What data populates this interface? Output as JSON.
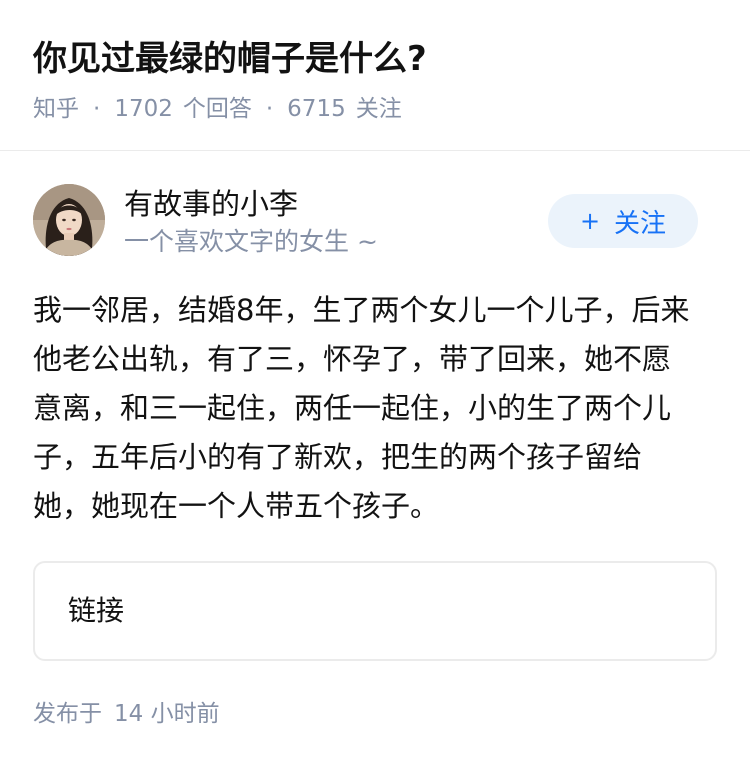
{
  "question": {
    "title": "你见过最绿的帽子是什么?",
    "source": "知乎",
    "answer_count": "1702",
    "answer_label": "个回答",
    "follower_count": "6715",
    "follower_label": "关注",
    "separator": "·"
  },
  "author": {
    "name": "有故事的小李",
    "bio": "一个喜欢文字的女生 ~",
    "avatar_icon": "avatar-photo",
    "follow_plus": "+",
    "follow_label": "关注"
  },
  "answer": {
    "lines": [
      "我一邻居，结婚8年，生了两个女儿一个儿子，后来",
      "他老公出轨，有了三，怀孕了，带了回来，她不愿",
      "意离，和三一起住，两任一起住，小的生了两个儿",
      "子，五年后小的有了新欢，把生的两个孩子留给",
      "她，她现在一个人带五个孩子。"
    ]
  },
  "link_card": {
    "label": "链接"
  },
  "footer": {
    "published_prefix": "发布于",
    "published_time": "14 小时前"
  },
  "colors": {
    "accent": "#1772f6",
    "follow_bg": "#ebf3fb",
    "meta_text": "#8590a6",
    "body_text": "#121212",
    "border": "#ebebeb"
  }
}
